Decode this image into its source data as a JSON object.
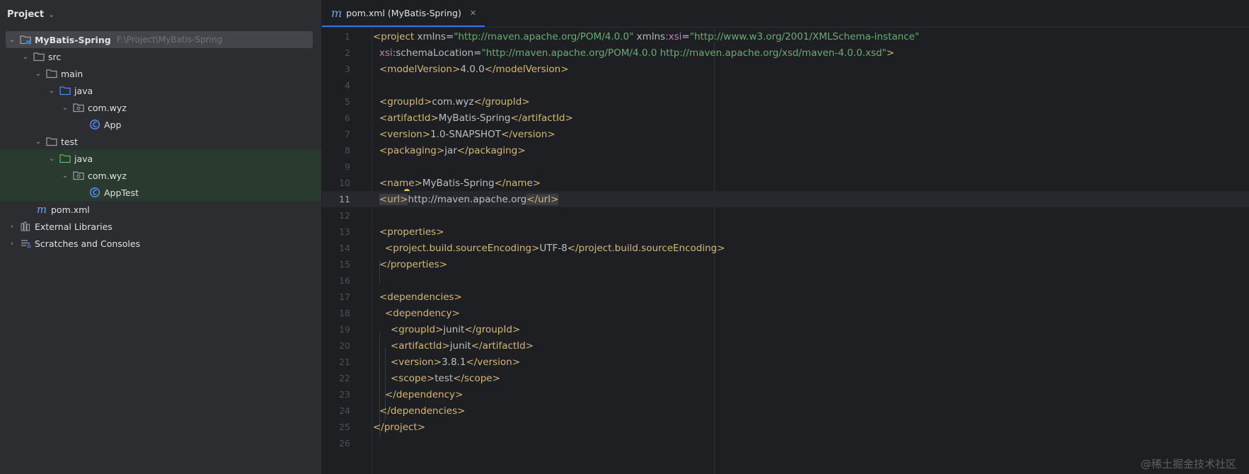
{
  "panel": {
    "title": "Project",
    "tree": [
      {
        "label": "MyBatis-Spring",
        "hint": "F:\\Project\\MyBatis-Spring"
      },
      {
        "label": "src"
      },
      {
        "label": "main"
      },
      {
        "label": "java"
      },
      {
        "label": "com.wyz"
      },
      {
        "label": "App"
      },
      {
        "label": "test"
      },
      {
        "label": "java"
      },
      {
        "label": "com.wyz"
      },
      {
        "label": "AppTest"
      },
      {
        "label": "pom.xml"
      },
      {
        "label": "External Libraries"
      },
      {
        "label": "Scratches and Consoles"
      }
    ]
  },
  "editor": {
    "tab": {
      "icon_letter": "m",
      "label": "pom.xml (MyBatis-Spring)"
    },
    "line_numbers": [
      "1",
      "2",
      "3",
      "4",
      "5",
      "6",
      "7",
      "8",
      "9",
      "10",
      "11",
      "12",
      "13",
      "14",
      "15",
      "16",
      "17",
      "18",
      "19",
      "20",
      "21",
      "22",
      "23",
      "24",
      "25",
      "26"
    ],
    "current_line": "11",
    "lines": {
      "l1": {
        "open": "<project",
        "a1": " xmlns",
        "eq1": "=",
        "v1": "\"http://maven.apache.org/POM/4.0.0\"",
        "a2": " xmlns",
        "ns2": ":xsi",
        "eq2": "=",
        "v2": "\"http://www.w3.org/2001/XMLSchema-instance\""
      },
      "l2": {
        "ns": "xsi",
        "a": ":schemaLocation",
        "eq": "=",
        "v": "\"http://maven.apache.org/POM/4.0.0 http://maven.apache.org/xsd/maven-4.0.0.xsd\"",
        "close": ">"
      },
      "l3": {
        "o": "<modelVersion>",
        "t": "4.0.0",
        "c": "</modelVersion>"
      },
      "l5": {
        "o": "<groupId>",
        "t": "com.wyz",
        "c": "</groupId>"
      },
      "l6": {
        "o": "<artifactId>",
        "t": "MyBatis-Spring",
        "c": "</artifactId>"
      },
      "l7": {
        "o": "<version>",
        "t": "1.0-SNAPSHOT",
        "c": "</version>"
      },
      "l8": {
        "o": "<packaging>",
        "t": "jar",
        "c": "</packaging>"
      },
      "l10": {
        "o": "<name>",
        "t": "MyBatis-Spring",
        "c": "</name>"
      },
      "l11": {
        "o": "<url>",
        "t": "http://maven.apache.org",
        "c": "</url>"
      },
      "l13": {
        "o": "<properties>"
      },
      "l14": {
        "o": "<project.build.sourceEncoding>",
        "t": "UTF-8",
        "c": "</project.build.sourceEncoding>"
      },
      "l15": {
        "c": "</properties>"
      },
      "l17": {
        "o": "<dependencies>"
      },
      "l18": {
        "o": "<dependency>"
      },
      "l19": {
        "o": "<groupId>",
        "t": "junit",
        "c": "</groupId>"
      },
      "l20": {
        "o": "<artifactId>",
        "t": "junit",
        "c": "</artifactId>"
      },
      "l21": {
        "o": "<version>",
        "t": "3.8.1",
        "c": "</version>"
      },
      "l22": {
        "o": "<scope>",
        "t": "test",
        "c": "</scope>"
      },
      "l23": {
        "c": "</dependency>"
      },
      "l24": {
        "c": "</dependencies>"
      },
      "l25": {
        "c": "</project>"
      }
    }
  },
  "watermark": "@稀土掘金技术社区",
  "colors": {
    "accent": "#3574f0",
    "tag": "#d5b778",
    "string": "#6aab73",
    "namespace": "#c77dbb"
  }
}
